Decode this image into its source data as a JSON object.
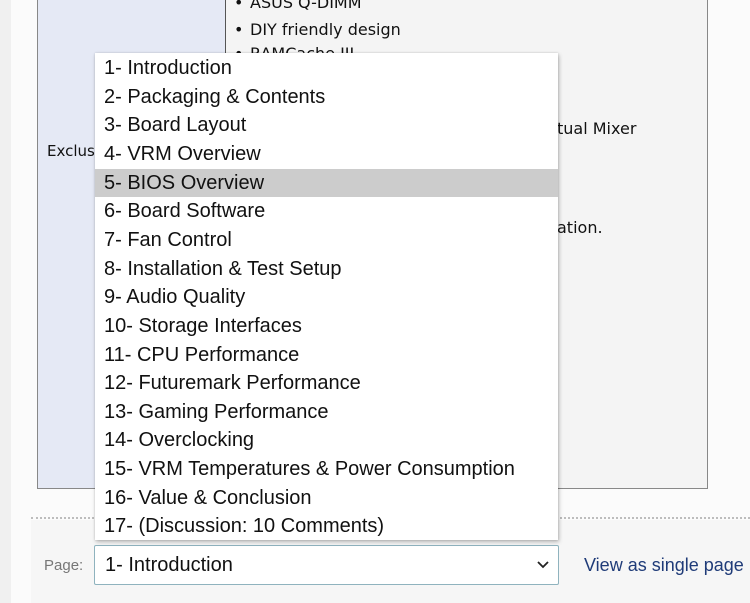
{
  "spec_table": {
    "left_label": "Exclusive Features",
    "features": [
      "ASUS Q-DIMM",
      "DIY friendly design",
      "RAMCache III",
      "",
      "ASUS Virtual Mixer",
      "",
      "",
      "configuration."
    ],
    "visible_fragments": {
      "row0": "ASUS Q-DIMM",
      "row1": "DIY friendly design",
      "row2": "RAMCache III",
      "row4_tail": "tual Mixer",
      "row7_tail": "ation."
    }
  },
  "pager": {
    "label": "Page:",
    "selected_value": "1- Introduction",
    "chevron_icon": "chevron-down-icon",
    "single_page_link": "View as single page"
  },
  "dropdown": {
    "highlighted_index": 4,
    "options": [
      "1- Introduction",
      "2- Packaging & Contents",
      "3- Board Layout",
      "4- VRM Overview",
      "5- BIOS Overview",
      "6- Board Software",
      "7- Fan Control",
      "8- Installation & Test Setup",
      "9- Audio Quality",
      "10- Storage Interfaces",
      "11- CPU Performance",
      "12- Futuremark Performance",
      "13- Gaming Performance",
      "14- Overclocking",
      "15- VRM Temperatures & Power Consumption",
      "16- Value & Conclusion",
      "17- (Discussion: 10 Comments)"
    ]
  },
  "colors": {
    "link": "#1f3b78",
    "highlight": "#cccccc",
    "select_border": "#8fb3be",
    "left_cell_bg": "#e5e9f5"
  }
}
